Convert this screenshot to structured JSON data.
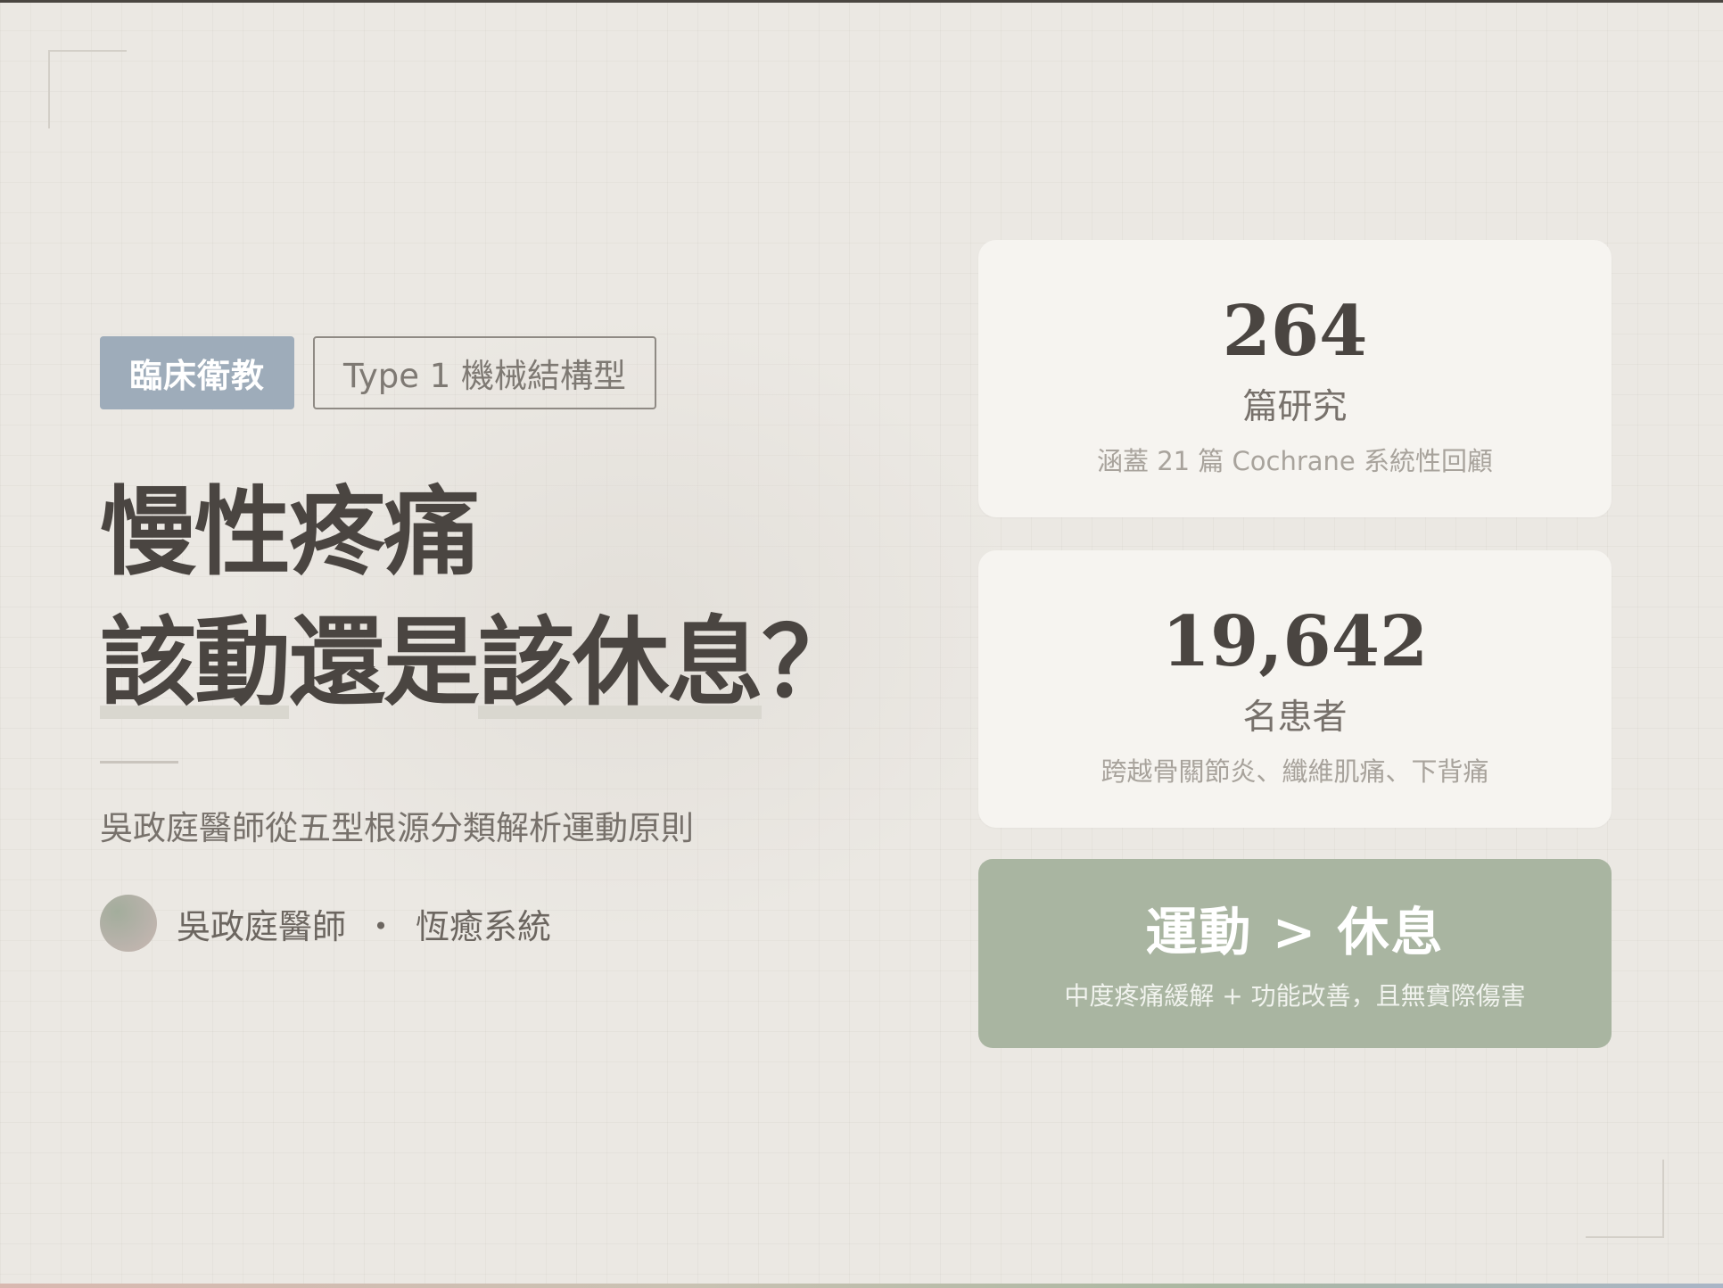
{
  "tags": {
    "primary": "臨床衛教",
    "secondary": "Type 1 機械結構型"
  },
  "headline": {
    "line1": "慢性疼痛",
    "line2_part1": "該動",
    "line2_part2": "還是",
    "line2_part3": "該休息",
    "line2_part4": "？"
  },
  "subtitle": "吳政庭醫師從五型根源分類解析運動原則",
  "author": {
    "name": "吳政庭醫師",
    "separator": "・",
    "org": "恆癒系統"
  },
  "stats": [
    {
      "value": "264",
      "unit": "篇研究",
      "note": "涵蓋 21 篇 Cochrane 系統性回顧"
    },
    {
      "value": "19,642",
      "unit": "名患者",
      "note": "跨越骨關節炎、纖維肌痛、下背痛"
    }
  ],
  "conclusion": {
    "title": "運動 > 休息",
    "detail": "中度疼痛緩解 + 功能改善，且無實際傷害"
  },
  "colors": {
    "background": "#ebe8e3",
    "tag_primary": "#9eacba",
    "card": "#f6f4f0",
    "accent_green": "#a9b5a1",
    "text_dark": "#4a4541"
  }
}
